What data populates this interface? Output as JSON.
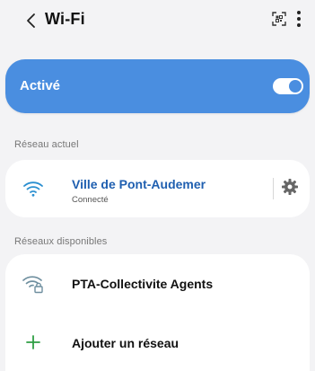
{
  "header": {
    "title": "Wi-Fi",
    "back_icon": "chevron-left-icon",
    "qr_icon": "qr-code-scan-icon",
    "more_icon": "more-vertical-icon"
  },
  "wifi_toggle": {
    "label": "Activé",
    "enabled": true
  },
  "current_network": {
    "section_label": "Réseau actuel",
    "name": "Ville de Pont-Audemer",
    "status": "Connecté",
    "icon": "wifi-icon",
    "settings_icon": "gear-icon"
  },
  "available_networks": {
    "section_label": "Réseaux disponibles",
    "items": [
      {
        "name": "PTA-Collectivite Agents",
        "icon": "wifi-lock-icon"
      }
    ],
    "add_label": "Ajouter un réseau",
    "add_icon": "plus-icon"
  },
  "colors": {
    "accent": "#4a8ee0",
    "connected_text": "#1f5fb0",
    "plus_green": "#2f9e44",
    "background": "#f3f3f5"
  }
}
